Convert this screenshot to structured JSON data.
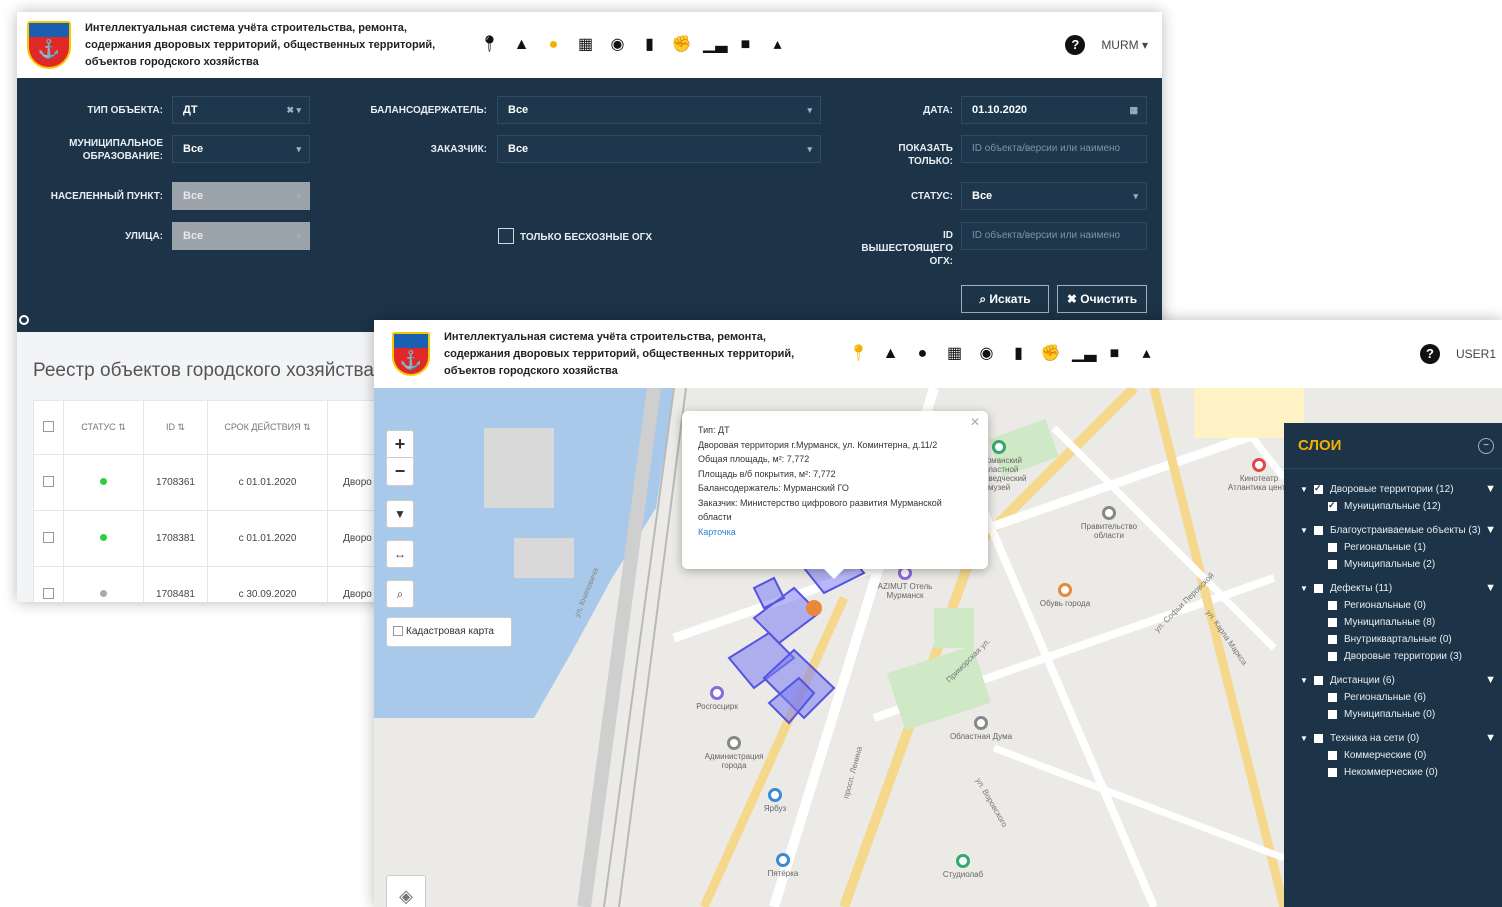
{
  "app": {
    "title": "Интеллектуальная система учёта строительства, ремонта, содержания дворовых территорий, общественных территорий, объектов городского хозяйства",
    "help_icon": "?",
    "toolbar_icons": [
      "map-marker-icon",
      "road-icon",
      "lightbulb-icon",
      "tree-icon",
      "calendar-icon",
      "eye-icon",
      "book-icon",
      "thumbs-up-icon",
      "bar-chart-icon",
      "documents-icon",
      "user-icon"
    ]
  },
  "window1": {
    "user": "MURM",
    "active_icon_index": 2,
    "filters": {
      "object_type": {
        "label": "ТИП ОБЪЕКТА:",
        "value": "ДТ"
      },
      "municipality": {
        "label": "МУНИЦИПАЛЬНОЕ ОБРАЗОВАНИЕ:",
        "value": "Все"
      },
      "settlement": {
        "label": "НАСЕЛЕННЫЙ ПУНКТ:",
        "value": "Все"
      },
      "street": {
        "label": "УЛИЦА:",
        "value": "Все"
      },
      "holder": {
        "label": "БАЛАНСОДЕРЖАТЕЛЬ:",
        "value": "Все"
      },
      "customer": {
        "label": "ЗАКАЗЧИК:",
        "value": "Все"
      },
      "only_unowned": {
        "label": "ТОЛЬКО БЕСХОЗНЫЕ ОГХ",
        "checked": false
      },
      "date": {
        "label": "ДАТА:",
        "value": "01.10.2020"
      },
      "show_only": {
        "label": "ПОКАЗАТЬ ТОЛЬКО:",
        "placeholder": "ID объекта/версии или наимено"
      },
      "status": {
        "label": "СТАТУС:",
        "value": "Все"
      },
      "parent_id": {
        "label": "ID ВЫШЕСТОЯЩЕГО ОГХ:",
        "placeholder": "ID объекта/версии или наимено"
      }
    },
    "search_button": "Искать",
    "clear_button": "Очистить",
    "registry": {
      "title": "Реестр объектов городского хозяйства",
      "columns": [
        "СТАТУС",
        "ID",
        "СРОК ДЕЙСТВИЯ"
      ],
      "rows": [
        {
          "status": "active",
          "id": "1708361",
          "validity": "с 01.01.2020",
          "name": "Дворо"
        },
        {
          "status": "active",
          "id": "1708381",
          "validity": "с 01.01.2020",
          "name": "Дворо"
        },
        {
          "status": "inactive",
          "id": "1708481",
          "validity": "с 30.09.2020",
          "name": "Дворо"
        }
      ]
    }
  },
  "window2": {
    "user": "USER1",
    "active_icon_index": 0,
    "map": {
      "zoom_in": "+",
      "zoom_out": "−",
      "cadastral_label": "Кадастровая карта",
      "popup": {
        "lines": [
          "Тип: ДТ",
          "Дворовая территория г.Мурманск, ул. Коминтерна, д.11/2",
          "Общая площадь, м²: 7,772",
          "Площадь в/б покрытия, м²: 7,772",
          "Балансодержатель: Мурманский ГО",
          "Заказчик: Министерство цифрового развития Мурманской области"
        ],
        "link": "Карточка"
      },
      "pois": [
        {
          "label": "Мурманский областной краеведческий музей",
          "color": "#36a86b"
        },
        {
          "label": "Правительство области",
          "color": "#888888"
        },
        {
          "label": "Кинотеатр Атлантика центр",
          "color": "#e04848"
        },
        {
          "label": "Обувь города",
          "color": "#e8883a"
        },
        {
          "label": "AZIMUT Отель Мурманск",
          "color": "#8a6ad8"
        },
        {
          "label": "Росгосцирк",
          "color": "#8a6ad8"
        },
        {
          "label": "Администрация города",
          "color": "#888888"
        },
        {
          "label": "Ярбуз",
          "color": "#3a8ad8"
        },
        {
          "label": "Пятёрка",
          "color": "#3a8ad8"
        },
        {
          "label": "Областная Дума",
          "color": "#888888"
        },
        {
          "label": "Студиолаб",
          "color": "#36a86b"
        }
      ],
      "streets": [
        "ул. Книповича",
        "ул. Карла Маркса",
        "ул. Софьи Перовской",
        "просп. Ленина",
        "ул. Воровского",
        "Приморская ул."
      ]
    },
    "layers": {
      "title": "СЛОИ",
      "items": [
        {
          "label": "Дворовые территории (12)",
          "level": 0,
          "checked": true,
          "filter": true
        },
        {
          "label": "Муниципальные (12)",
          "level": 1,
          "checked": true
        },
        {
          "label": "Благоустраиваемые объекты (3)",
          "level": 0,
          "checked": false,
          "filter": true
        },
        {
          "label": "Региональные (1)",
          "level": 1,
          "checked": false
        },
        {
          "label": "Муниципальные (2)",
          "level": 1,
          "checked": false
        },
        {
          "label": "Дефекты (11)",
          "level": 0,
          "checked": false,
          "filter": true
        },
        {
          "label": "Региональные (0)",
          "level": 1,
          "checked": false
        },
        {
          "label": "Муниципальные (8)",
          "level": 1,
          "checked": false
        },
        {
          "label": "Внутриквартальные (0)",
          "level": 1,
          "checked": false
        },
        {
          "label": "Дворовые территории (3)",
          "level": 1,
          "checked": false
        },
        {
          "label": "Дистанции (6)",
          "level": 0,
          "checked": false,
          "filter": true
        },
        {
          "label": "Региональные (6)",
          "level": 1,
          "checked": false
        },
        {
          "label": "Муниципальные (0)",
          "level": 1,
          "checked": false
        },
        {
          "label": "Техника на сети (0)",
          "level": 0,
          "checked": false,
          "filter": true
        },
        {
          "label": "Коммерческие (0)",
          "level": 1,
          "checked": false
        },
        {
          "label": "Некоммерческие (0)",
          "level": 1,
          "checked": false
        }
      ]
    }
  }
}
